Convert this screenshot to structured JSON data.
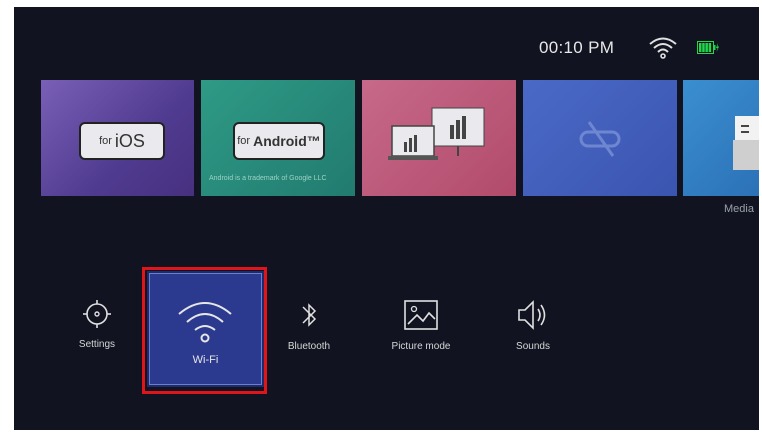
{
  "status_bar": {
    "time": "00:10 PM",
    "wifi_icon": "wifi-icon",
    "battery_icon": "battery-charging-icon",
    "colors": {
      "battery": "#22d84a"
    }
  },
  "tiles": [
    {
      "name": "ios-tile",
      "small": "for",
      "big": "iOS"
    },
    {
      "name": "android-tile",
      "small": "for",
      "big": "Android™",
      "footnote": "Android is a trademark of Google LLC"
    },
    {
      "name": "presentation-tile"
    },
    {
      "name": "screen-mirror-tile"
    },
    {
      "name": "media-tile",
      "label": "Media"
    }
  ],
  "menu": {
    "settings": "Settings",
    "wifi": "Wi-Fi",
    "bluetooth": "Bluetooth",
    "picture_mode": "Picture mode",
    "sounds": "Sounds"
  },
  "colors": {
    "background": "#111420",
    "selected_card": "#2b3a8f",
    "highlight": "#e0151b"
  }
}
